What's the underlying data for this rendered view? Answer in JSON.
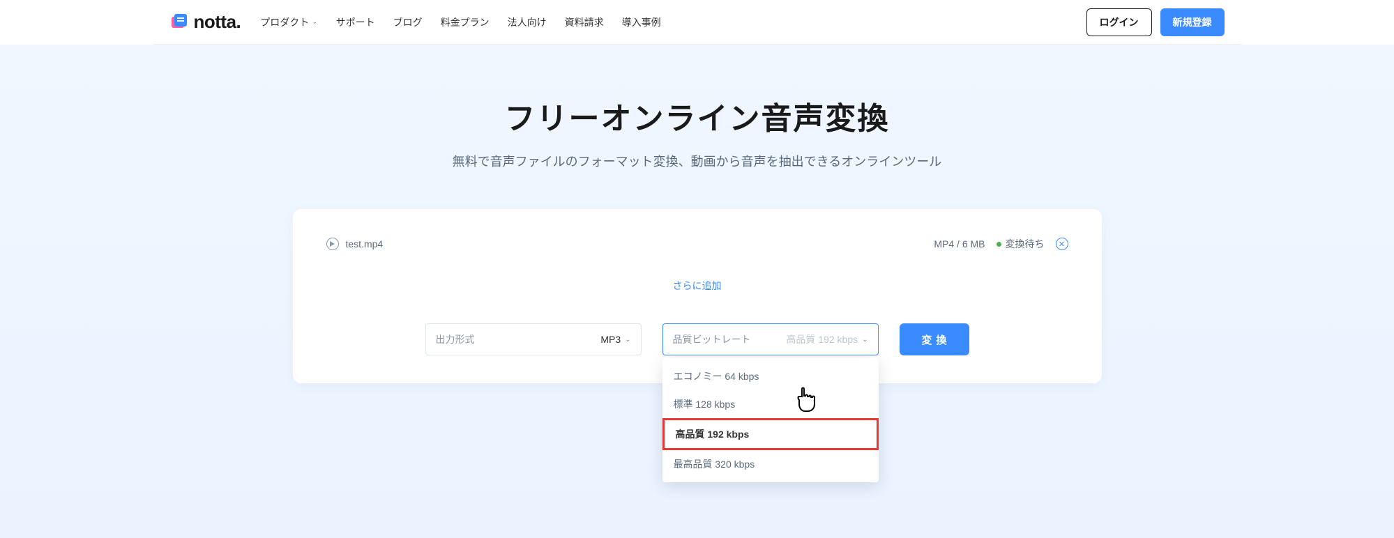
{
  "brand": "notta.",
  "nav": {
    "product": "プロダクト",
    "support": "サポート",
    "blog": "ブログ",
    "pricing": "料金プラン",
    "business": "法人向け",
    "request": "資料請求",
    "cases": "導入事例"
  },
  "header": {
    "login": "ログイン",
    "signup": "新規登録"
  },
  "page": {
    "title": "フリーオンライン音声変換",
    "subtitle": "無料で音声ファイルのフォーマット変換、動画から音声を抽出できるオンラインツール"
  },
  "file": {
    "name": "test.mp4",
    "meta": "MP4 / 6 MB",
    "status": "変換待ち"
  },
  "add_more": "さらに追加",
  "format": {
    "label": "出力形式",
    "value": "MP3"
  },
  "bitrate": {
    "label": "品質ビットレート",
    "value": "高品質 192 kbps",
    "options": [
      "エコノミー 64 kbps",
      "標準 128 kbps",
      "高品質 192 kbps",
      "最高品質 320 kbps"
    ]
  },
  "convert": "変換"
}
